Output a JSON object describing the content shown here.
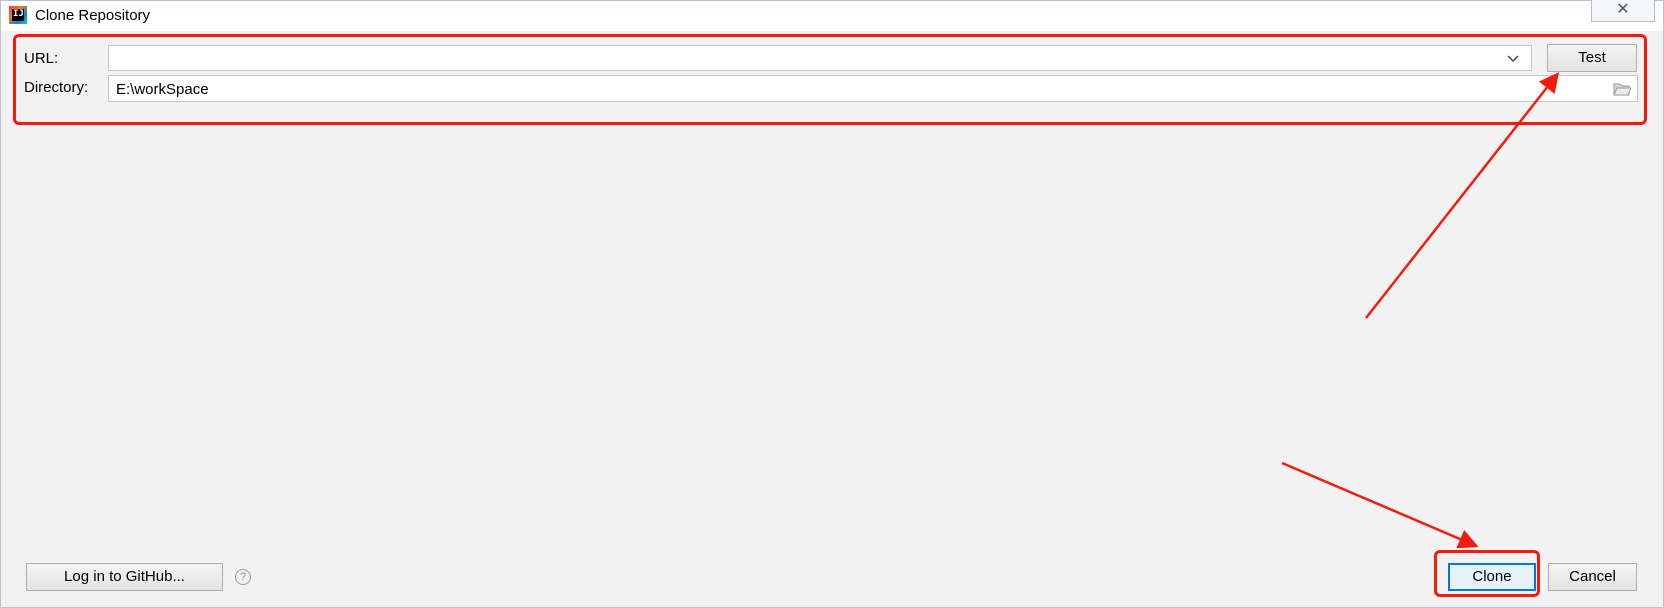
{
  "window": {
    "title": "Clone Repository",
    "app_icon_text": "IJ",
    "close_glyph": "✕"
  },
  "form": {
    "url_label": "URL:",
    "url_value": "",
    "directory_label": "Directory:",
    "directory_value": "E:\\workSpace"
  },
  "buttons": {
    "test": "Test",
    "github_login": "Log in to GitHub...",
    "help": "?",
    "clone": "Clone",
    "cancel": "Cancel"
  },
  "icons": {
    "url_dropdown": "chevron-down-icon",
    "directory_browse": "folder-icon",
    "help": "question-mark-icon"
  },
  "annotations": {
    "color": "#f21b0e",
    "highlights": [
      "url-and-directory-fields",
      "clone-button"
    ]
  },
  "colors": {
    "dialog_background": "#f2f2f2",
    "default_button_border": "#0078d7"
  }
}
